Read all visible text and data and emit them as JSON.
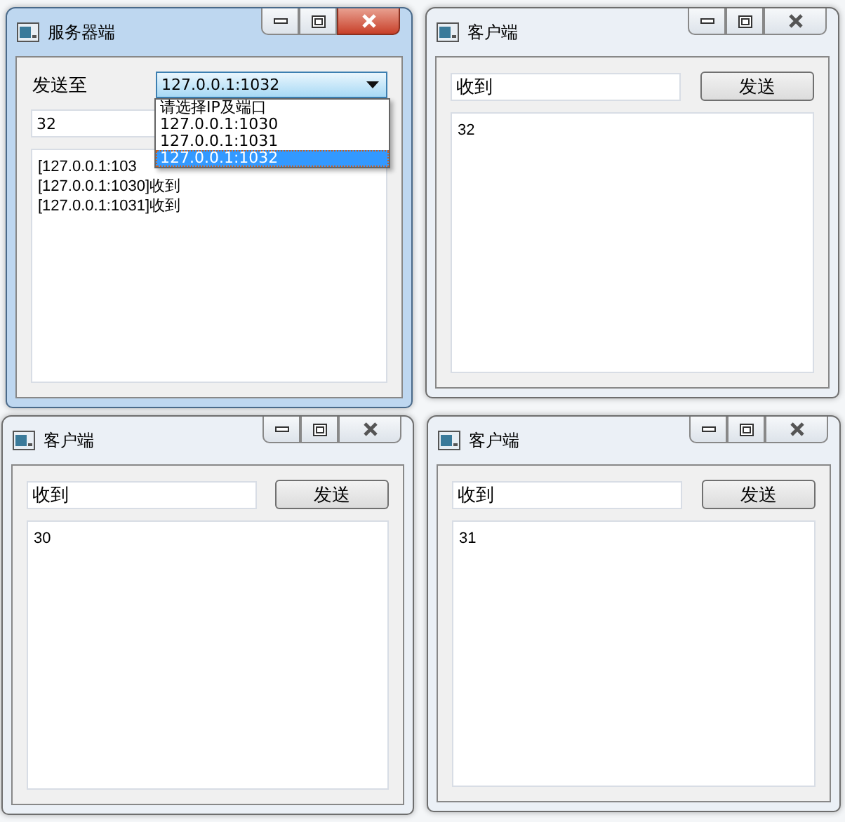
{
  "windows": [
    {
      "kind": "server",
      "title": "服务器端",
      "active": true,
      "send_to_label": "发送至",
      "combo_value": "127.0.0.1:1032",
      "dropdown": [
        {
          "label": "请选择IP及端口",
          "selected": false
        },
        {
          "label": "127.0.0.1:1030",
          "selected": false
        },
        {
          "label": "127.0.0.1:1031",
          "selected": false
        },
        {
          "label": "127.0.0.1:1032",
          "selected": true
        }
      ],
      "message": "32",
      "log": [
        "[127.0.0.1:103",
        "[127.0.0.1:1030]收到",
        "[127.0.0.1:1031]收到"
      ]
    },
    {
      "kind": "client",
      "title": "客户端",
      "active": false,
      "message": "收到",
      "send_button": "发送",
      "log": [
        "32"
      ]
    },
    {
      "kind": "client",
      "title": "客户端",
      "active": false,
      "message": "收到",
      "send_button": "发送",
      "log": [
        "30"
      ]
    },
    {
      "kind": "client",
      "title": "客户端",
      "active": false,
      "message": "收到",
      "send_button": "发送",
      "log": [
        "31"
      ]
    }
  ]
}
